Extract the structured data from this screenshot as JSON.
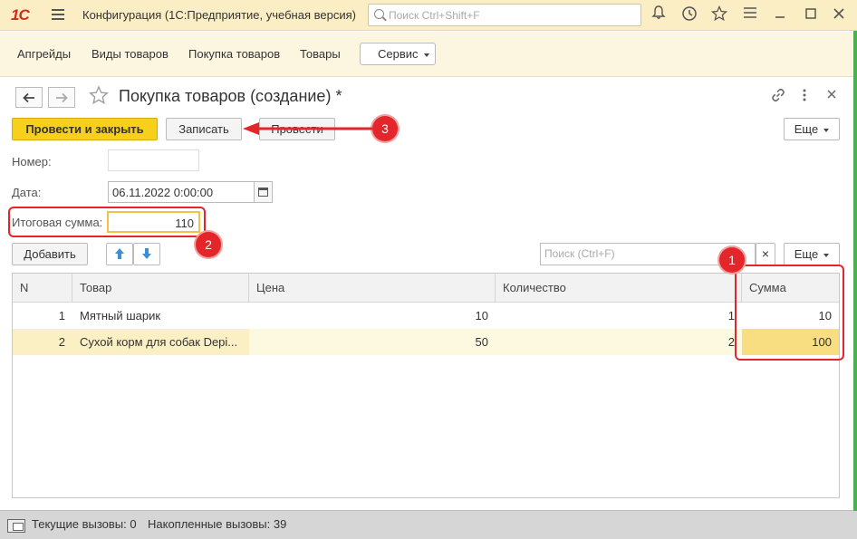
{
  "titlebar": {
    "logo": "1С",
    "title": "Конфигурация  (1С:Предприятие, учебная версия)",
    "search_placeholder": "Поиск Ctrl+Shift+F",
    "icons": [
      "bell-icon",
      "history-icon",
      "star-icon",
      "settings-icon",
      "minimize-icon",
      "maximize-icon",
      "close-icon"
    ]
  },
  "nav": {
    "items": [
      "Апгрейды",
      "Виды товаров",
      "Покупка товаров",
      "Товары"
    ],
    "service": "Сервис"
  },
  "form": {
    "title": "Покупка товаров (создание) *",
    "buttons": {
      "post_close": "Провести и закрыть",
      "save": "Записать",
      "post": "Провести",
      "more": "Еще"
    },
    "number_label": "Номер:",
    "number_value": "",
    "date_label": "Дата:",
    "date_value": "06.11.2022  0:00:00",
    "total_label": "Итоговая сумма:",
    "total_value": "110"
  },
  "table_toolbar": {
    "add": "Добавить",
    "search_placeholder": "Поиск (Ctrl+F)",
    "clear": "×",
    "more": "Еще"
  },
  "table": {
    "columns": [
      "N",
      "Товар",
      "Цена",
      "Количество",
      "Сумма"
    ],
    "rows": [
      {
        "n": "1",
        "product": "Мятный шарик",
        "price": "10",
        "qty": "1",
        "sum": "10"
      },
      {
        "n": "2",
        "product": "Сухой корм для собак Depi...",
        "price": "50",
        "qty": "2",
        "sum": "100"
      }
    ]
  },
  "annotations": [
    "1",
    "2",
    "3"
  ],
  "status": {
    "current_calls": "Текущие вызовы: 0",
    "accumulated_calls": "Накопленные вызовы: 39"
  },
  "colors": {
    "primary_button": "#f6d01a",
    "annotation": "#e3262a",
    "titlebar": "#fbeec4",
    "selected_row": "#fbf0c4"
  }
}
